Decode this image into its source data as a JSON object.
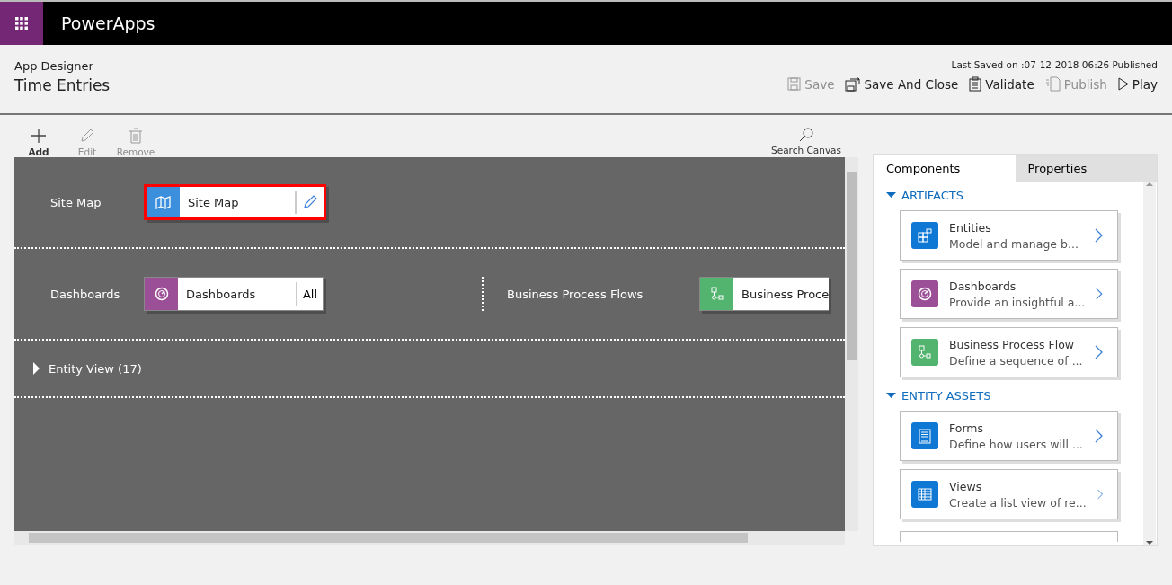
{
  "app_bar": {
    "title": "PowerApps"
  },
  "header": {
    "subtitle": "App Designer",
    "title": "Time Entries",
    "last_saved": "Last Saved on :07-12-2018 06:26 Published",
    "actions": [
      {
        "label": "Save",
        "kind": "save",
        "disabled": true
      },
      {
        "label": "Save And Close",
        "kind": "save-close",
        "disabled": false
      },
      {
        "label": "Validate",
        "kind": "validate",
        "disabled": false
      },
      {
        "label": "Publish",
        "kind": "publish",
        "disabled": true
      },
      {
        "label": "Play",
        "kind": "play",
        "disabled": false
      }
    ]
  },
  "toolbar": {
    "items": [
      {
        "label": "Add",
        "kind": "add",
        "disabled": false
      },
      {
        "label": "Edit",
        "kind": "edit",
        "disabled": true
      },
      {
        "label": "Remove",
        "kind": "remove",
        "disabled": true
      }
    ],
    "search": {
      "label": "Search Canvas"
    }
  },
  "canvas": {
    "rows": [
      {
        "sections": [
          {
            "label": "Site Map",
            "tile": {
              "label": "Site Map",
              "kind": "map",
              "color": "#3c8fdc",
              "action": {
                "kind": "edit"
              },
              "highlighted": true
            }
          }
        ]
      },
      {
        "sections": [
          {
            "label": "Dashboards",
            "tile": {
              "label": "Dashboards",
              "kind": "gauge",
              "color": "#9b4f96",
              "action": {
                "kind": "text",
                "label": "All"
              },
              "highlighted": false
            }
          },
          {
            "label": "Business Process Flows",
            "tile": {
              "label": "Business Proce",
              "kind": "flow",
              "color": "#52b46f",
              "highlighted": false
            }
          }
        ]
      }
    ],
    "entity_view": {
      "label": "Entity View (17)",
      "expanded": false
    }
  },
  "panel": {
    "tabs": [
      {
        "label": "Components",
        "selected": true
      },
      {
        "label": "Properties",
        "selected": false
      }
    ],
    "groups": [
      {
        "title": "ARTIFACTS",
        "expanded": true,
        "items": [
          {
            "title": "Entities",
            "description": "Model and manage b...",
            "kind": "entities",
            "color": "#0f78d4"
          },
          {
            "title": "Dashboards",
            "description": "Provide an insightful a...",
            "kind": "gauge",
            "color": "#9b4f96"
          },
          {
            "title": "Business Process Flow",
            "description": "Define a sequence of ...",
            "kind": "flow",
            "color": "#52b46f"
          }
        ]
      },
      {
        "title": "ENTITY ASSETS",
        "expanded": true,
        "items": [
          {
            "title": "Forms",
            "description": "Define how users will ...",
            "kind": "forms",
            "color": "#0f78d4"
          },
          {
            "title": "Views",
            "description": "Create a list view of re...",
            "kind": "views",
            "color": "#0f78d4"
          }
        ]
      }
    ]
  }
}
